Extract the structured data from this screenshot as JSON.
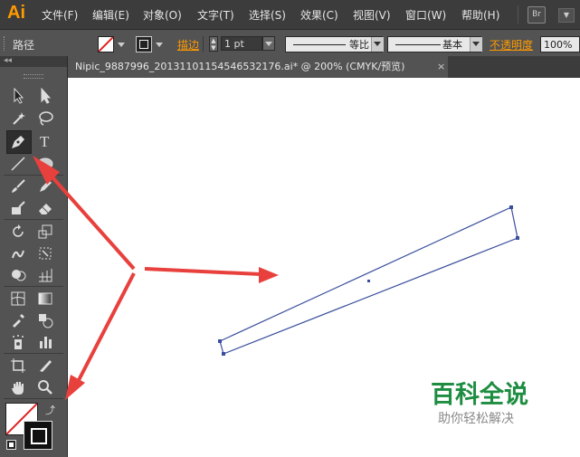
{
  "app": {
    "logo": "Ai"
  },
  "menubar": {
    "items": [
      "文件(F)",
      "编辑(E)",
      "对象(O)",
      "文字(T)",
      "选择(S)",
      "效果(C)",
      "视图(V)",
      "窗口(W)",
      "帮助(H)"
    ],
    "bridge": "Br"
  },
  "control_bar": {
    "selection_label": "路径",
    "stroke_link": "描边",
    "stroke_weight": "1 pt",
    "profile_label": "等比",
    "brush_label": "基本",
    "opacity_link": "不透明度",
    "opacity_value": "100%"
  },
  "document_tab": {
    "title": "Nipic_9887996_20131101154546532176.ai* @ 200% (CMYK/预览)",
    "close": "×"
  },
  "watermark": {
    "title": "百科全说",
    "subtitle": "助你轻松解决"
  },
  "colors": {
    "accent": "#ff9a00",
    "arrow": "#e8403c",
    "path": "#3a4f9c",
    "watermark": "#1e8d41"
  }
}
